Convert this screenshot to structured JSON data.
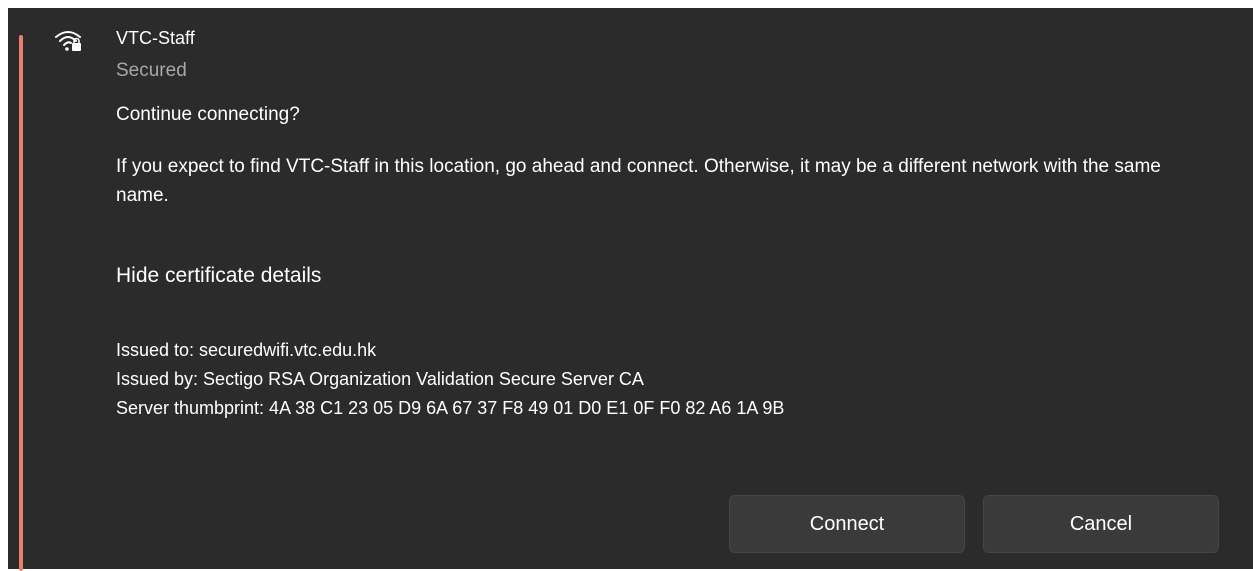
{
  "network": {
    "name": "VTC-Staff",
    "status": "Secured",
    "icon": "wifi-secured-icon"
  },
  "prompt": {
    "title": "Continue connecting?",
    "body": "If you expect to find VTC-Staff in this location, go ahead and connect. Otherwise, it may be a different network with the same name."
  },
  "certificate": {
    "toggle_label": "Hide certificate details",
    "issued_to": "Issued to: securedwifi.vtc.edu.hk",
    "issued_by": "Issued by: Sectigo RSA Organization Validation Secure Server CA",
    "thumbprint": "Server thumbprint: 4A 38 C1 23 05 D9 6A 67 37 F8 49 01 D0 E1 0F F0 82 A6 1A 9B"
  },
  "buttons": {
    "connect_label": "Connect",
    "cancel_label": "Cancel"
  },
  "colors": {
    "panel_background": "#2b2b2b",
    "accent": "#e8816c",
    "button_background": "#3a3a3a",
    "secondary_text": "#a8a8a8"
  }
}
